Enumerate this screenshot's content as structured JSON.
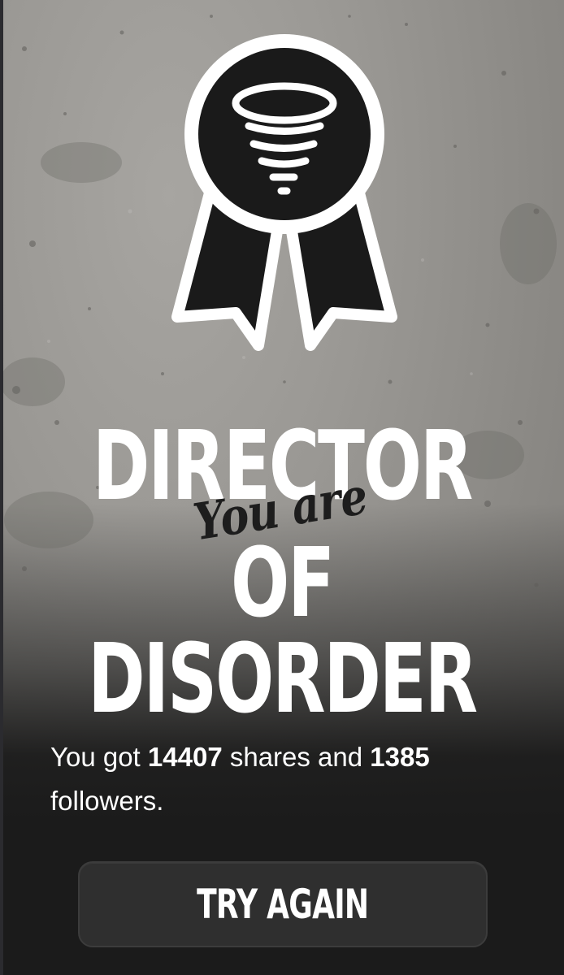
{
  "badge": {
    "icon": "tornado-icon"
  },
  "title": {
    "line1": "DIRECTOR",
    "script": "You are",
    "line2": "OF DISORDER"
  },
  "result": {
    "prefix": "You got ",
    "shares": "14407",
    "middle": " shares and ",
    "followers": "1385",
    "suffix": " followers."
  },
  "actions": {
    "try_again": "TRY AGAIN"
  },
  "colors": {
    "background_gray": "#9a9894",
    "bottom_dark": "#1b1b1b",
    "button": "#2f2f2f",
    "text": "#ffffff",
    "badge": "#1a1a1a"
  }
}
